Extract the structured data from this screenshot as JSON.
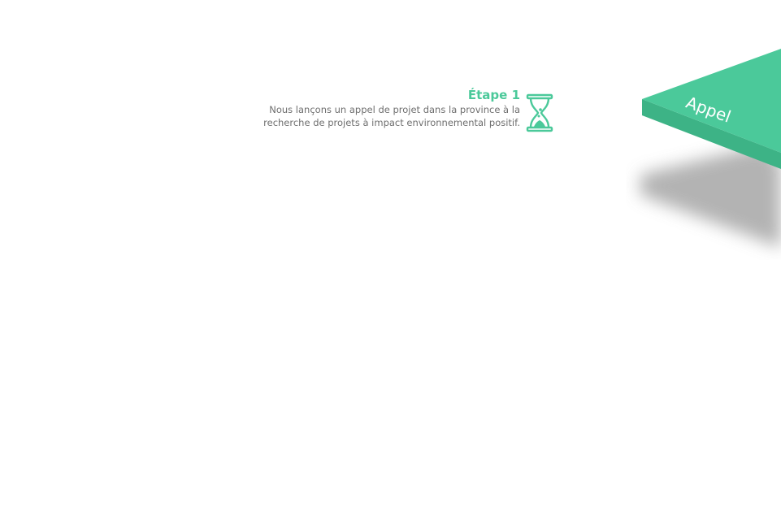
{
  "step": {
    "title": "Étape 1",
    "description_line1": "Nous lançons un appel de projet dans la province à la",
    "description_line2": "recherche de projets à impact environnemental positif.",
    "icon": "hourglass-icon"
  },
  "shape": {
    "label": "Appel"
  },
  "colors": {
    "accent": "#4bc99a",
    "accent_dark": "#3db386",
    "text_muted": "#6f6f6f",
    "shadow": "#9a9a9a"
  }
}
